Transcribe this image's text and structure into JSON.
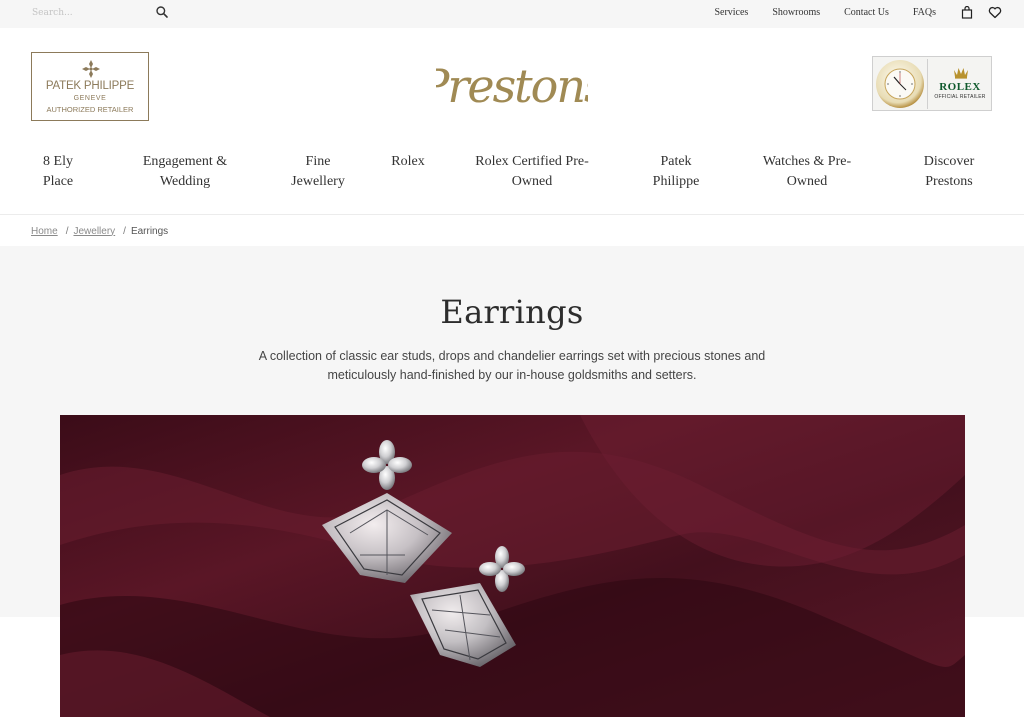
{
  "search": {
    "placeholder": "Search..."
  },
  "utility_links": [
    "Services",
    "Showrooms",
    "Contact Us",
    "FAQs"
  ],
  "utility_icons": [
    "bag-icon",
    "heart-icon"
  ],
  "patek_badge": {
    "name": "PATEK PHILIPPE",
    "city": "GENEVE",
    "retailer": "AUTHORIZED RETAILER"
  },
  "brand": {
    "logo_text": "Prestons"
  },
  "rolex_plaque": {
    "brand": "ROLEX",
    "tagline": "OFFICIAL RETAILER"
  },
  "nav": [
    "8 Ely\nPlace",
    "Engagement &\nWedding",
    "Fine\nJewellery",
    "Rolex",
    "Rolex Certified Pre-\nOwned",
    "Patek\nPhilippe",
    "Watches & Pre-\nOwned",
    "Discover\nPrestons"
  ],
  "breadcrumb": {
    "home": "Home",
    "jewellery": "Jewellery",
    "current": "Earrings",
    "separator": "/"
  },
  "category": {
    "title": "Earrings",
    "description": "A collection of classic ear studs, drops and chandelier earrings set with precious stones and meticulously hand-finished by our in-house goldsmiths and setters."
  },
  "colors": {
    "accent_gold": "#8c7a5a",
    "logo_gold": "#a08a54",
    "rolex_green": "#0f5a2d",
    "hero_burgundy": "#4a1220"
  }
}
